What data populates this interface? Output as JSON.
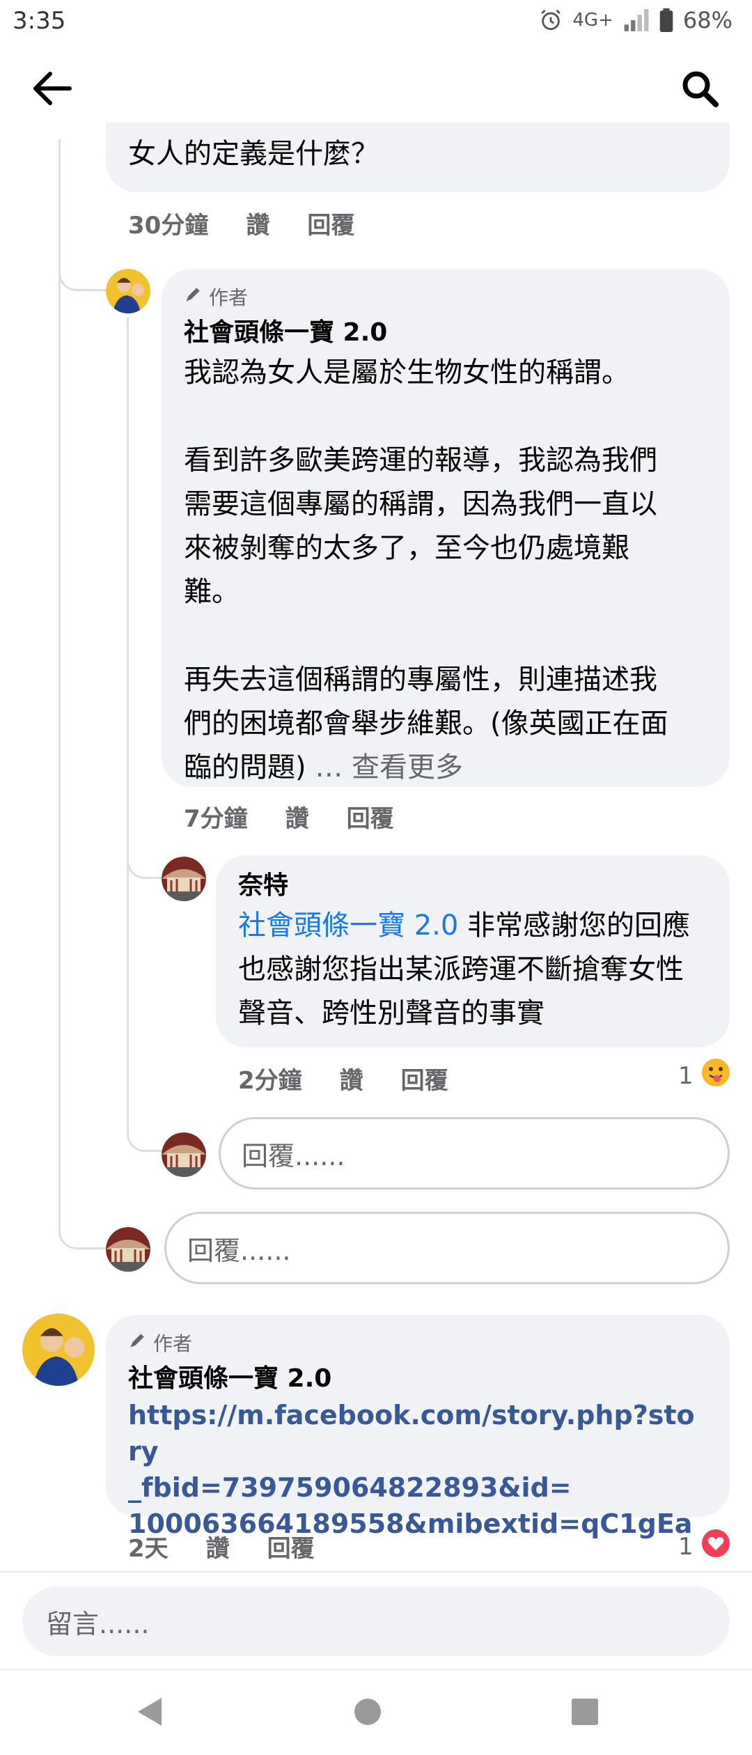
{
  "status_bar": {
    "time": "3:35",
    "network": "4G+",
    "battery": "68%"
  },
  "icons": {
    "back": "arrow-left-icon",
    "search": "search-icon",
    "alarm": "alarm-icon",
    "signal": "signal-icon",
    "battery": "battery-icon",
    "author_badge": "pencil-icon",
    "reaction_wow": "tongue-out-face-icon",
    "reaction_love": "heart-icon"
  },
  "parent_comment": {
    "text_tail": "女人的定義是什麼？",
    "time": "30分鐘",
    "like_label": "讚",
    "reply_label": "回覆"
  },
  "reply_1": {
    "author_badge": "作者",
    "name": "社會頭條一寶 2.0",
    "text": "我認為女人是屬於生物女性的稱謂。\n\n看到許多歐美跨運的報導，我認為我們\n需要這個專屬的稱謂，因為我們一直以\n來被剝奪的太多了，至今也仍處境艱\n難。\n\n再失去這個稱謂的專屬性，則連描述我\n們的困境都會舉步維艱。(像英國正在面\n臨的問題) ",
    "see_more": "… 查看更多",
    "time": "7分鐘",
    "like_label": "讚",
    "reply_label": "回覆"
  },
  "reply_2": {
    "name": "奈特",
    "mention": "社會頭條一寶 2.0",
    "text_after_mention": " 非常感謝您的回應\n也感謝您指出某派跨運不斷搶奪女性\n聲音、跨性別聲音的事實",
    "time": "2分鐘",
    "like_label": "讚",
    "reply_label": "回覆",
    "reaction_count": "1"
  },
  "reply_input_nested": {
    "placeholder": "回覆......"
  },
  "reply_input_thread": {
    "placeholder": "回覆......"
  },
  "comment_2": {
    "author_badge": "作者",
    "name": "社會頭條一寶 2.0",
    "link": "https://m.facebook.com/story.php?story_fbid=739759064822893&id=100063664189558&mibextid=qC1gEa",
    "link_line1": "https://m.facebook.com/story.php?story",
    "link_line2": "_fbid=739759064822893&id=",
    "link_line3": "100063664189558&mibextid=qC1gEa",
    "time": "2天",
    "like_label": "讚",
    "reply_label": "回覆",
    "reaction_count": "1"
  },
  "comment_box": {
    "placeholder": "留言......"
  },
  "colors": {
    "link": "#385898",
    "mention": "#1877f2",
    "bubble": "#f0f2f5",
    "meta": "#65676b"
  }
}
